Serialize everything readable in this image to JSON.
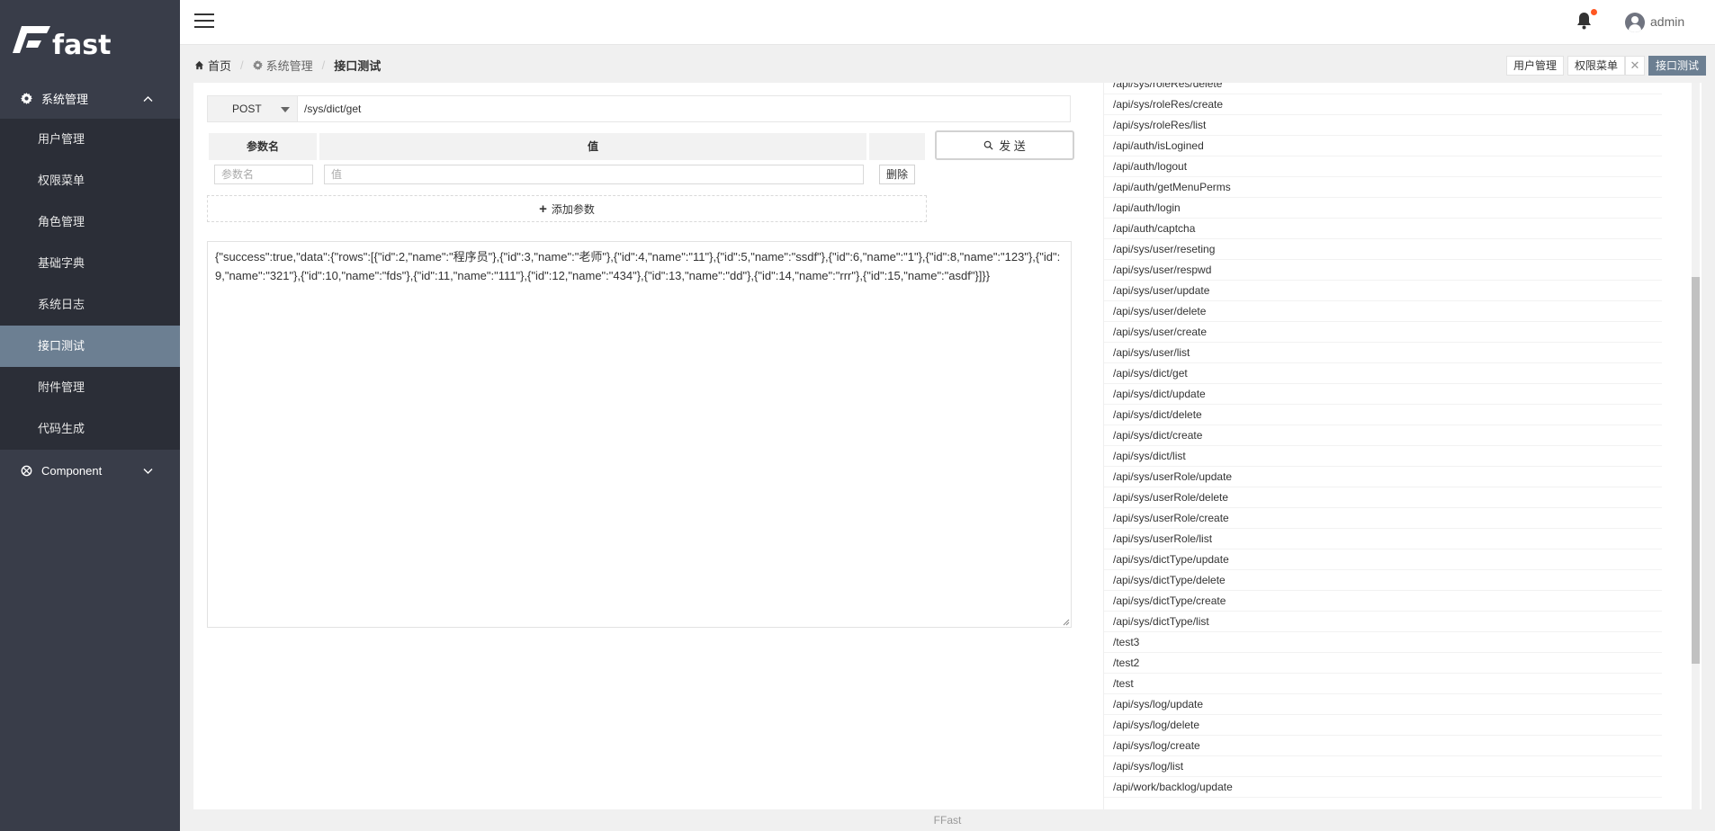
{
  "brand": {
    "name": "fast"
  },
  "sidebar": {
    "groups": [
      {
        "label": "系统管理",
        "icon": "gear-icon",
        "expanded": true,
        "items": [
          {
            "label": "用户管理"
          },
          {
            "label": "权限菜单"
          },
          {
            "label": "角色管理"
          },
          {
            "label": "基础字典"
          },
          {
            "label": "系统日志"
          },
          {
            "label": "接口测试",
            "active": true
          },
          {
            "label": "附件管理"
          },
          {
            "label": "代码生成"
          }
        ]
      },
      {
        "label": "Component",
        "icon": "component-icon",
        "expanded": false
      }
    ]
  },
  "header": {
    "username": "admin",
    "notification_dot_color": "#ff5722"
  },
  "breadcrumb": {
    "home": "首页",
    "section": "系统管理",
    "current": "接口测试"
  },
  "tabs": [
    {
      "label": "用户管理"
    },
    {
      "label": "权限菜单"
    },
    {
      "label": "接口测试",
      "active": true
    }
  ],
  "request": {
    "method": "POST",
    "url": "/sys/dict/get",
    "send_label": "发 送",
    "params_header": {
      "name": "参数名",
      "value": "值"
    },
    "param_name_placeholder": "参数名",
    "param_value_placeholder": "值",
    "delete_label": "删除",
    "add_param_label": "添加参数"
  },
  "response": {
    "body": "{\"success\":true,\"data\":{\"rows\":[{\"id\":2,\"name\":\"程序员\"},{\"id\":3,\"name\":\"老师\"},{\"id\":4,\"name\":\"11\"},{\"id\":5,\"name\":\"ssdf\"},{\"id\":6,\"name\":\"1\"},{\"id\":8,\"name\":\"123\"},{\"id\":9,\"name\":\"321\"},{\"id\":10,\"name\":\"fds\"},{\"id\":11,\"name\":\"111\"},{\"id\":12,\"name\":\"434\"},{\"id\":13,\"name\":\"dd\"},{\"id\":14,\"name\":\"rrr\"},{\"id\":15,\"name\":\"asdf\"}]}}"
  },
  "api_list": [
    "/api/sys/roleRes/delete",
    "/api/sys/roleRes/create",
    "/api/sys/roleRes/list",
    "/api/auth/isLogined",
    "/api/auth/logout",
    "/api/auth/getMenuPerms",
    "/api/auth/login",
    "/api/auth/captcha",
    "/api/sys/user/reseting",
    "/api/sys/user/respwd",
    "/api/sys/user/update",
    "/api/sys/user/delete",
    "/api/sys/user/create",
    "/api/sys/user/list",
    "/api/sys/dict/get",
    "/api/sys/dict/update",
    "/api/sys/dict/delete",
    "/api/sys/dict/create",
    "/api/sys/dict/list",
    "/api/sys/userRole/update",
    "/api/sys/userRole/delete",
    "/api/sys/userRole/create",
    "/api/sys/userRole/list",
    "/api/sys/dictType/update",
    "/api/sys/dictType/delete",
    "/api/sys/dictType/create",
    "/api/sys/dictType/list",
    "/test3",
    "/test2",
    "/test",
    "/api/sys/log/update",
    "/api/sys/log/delete",
    "/api/sys/log/create",
    "/api/sys/log/list",
    "/api/work/backlog/update"
  ],
  "footer": "FFast"
}
